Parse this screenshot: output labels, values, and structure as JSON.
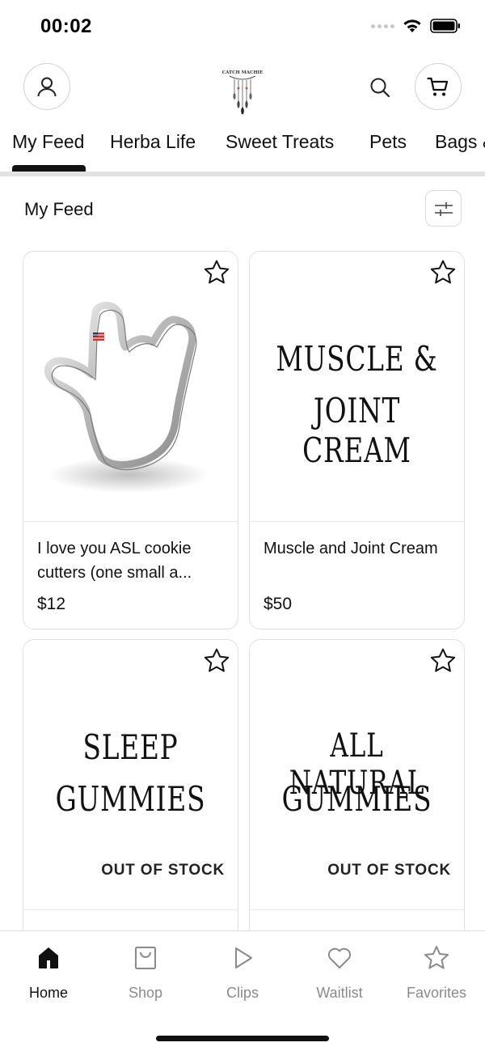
{
  "status_bar": {
    "time": "00:02"
  },
  "header": {
    "logo_text": "CATCH MACHIE",
    "icons": [
      "user-icon",
      "search-icon",
      "cart-icon"
    ]
  },
  "tabs": [
    {
      "label": "My Feed",
      "active": true
    },
    {
      "label": "Herba Life",
      "active": false
    },
    {
      "label": "Sweet Treats",
      "active": false
    },
    {
      "label": "Pets",
      "active": false
    },
    {
      "label": "Bags &",
      "active": false
    }
  ],
  "feed": {
    "title": "My Feed",
    "filter_icon": "sliders-icon"
  },
  "products": [
    {
      "name": "I love you ASL cookie cutters (one small a...",
      "price": "$12",
      "image_text_lines": [],
      "badge": "",
      "favorite_icon": "star-outline-icon"
    },
    {
      "name": "Muscle and Joint Cream",
      "price": "$50",
      "image_text_lines": [
        "MUSCLE &",
        "JOINT CREAM"
      ],
      "badge": "",
      "favorite_icon": "star-outline-icon"
    },
    {
      "name": "",
      "price": "",
      "image_text_lines": [
        "SLEEP",
        "GUMMIES"
      ],
      "badge": "OUT OF STOCK",
      "favorite_icon": "star-outline-icon"
    },
    {
      "name": "",
      "price": "",
      "image_text_lines": [
        "ALL NATURAL",
        "GUMMIES"
      ],
      "badge": "OUT OF STOCK",
      "favorite_icon": "star-outline-icon"
    }
  ],
  "bottom_nav": [
    {
      "label": "Home",
      "icon": "home-icon",
      "active": true
    },
    {
      "label": "Shop",
      "icon": "shop-bag-icon",
      "active": false
    },
    {
      "label": "Clips",
      "icon": "play-icon",
      "active": false
    },
    {
      "label": "Waitlist",
      "icon": "heart-icon",
      "active": false
    },
    {
      "label": "Favorites",
      "icon": "star-icon",
      "active": false
    }
  ],
  "colors": {
    "text": "#111111",
    "muted": "#8a8a8a",
    "border": "#e0e0e0"
  }
}
